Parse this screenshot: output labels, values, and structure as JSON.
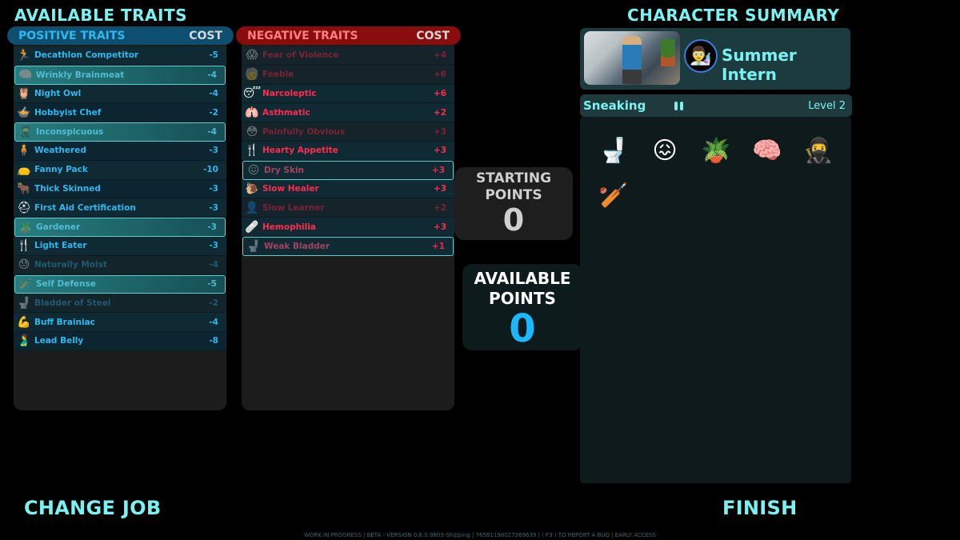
{
  "headings": {
    "available_traits": "AVAILABLE TRAITS",
    "character_summary": "CHARACTER SUMMARY"
  },
  "positive": {
    "title": "POSITIVE TRAITS",
    "cost_label": "COST",
    "traits": [
      {
        "name": "Decathlon Competitor",
        "cost": "-5",
        "icon": "runner-icon",
        "glyph": "🏃",
        "state": "available"
      },
      {
        "name": "Wrinkly Brainmeat",
        "cost": "-4",
        "icon": "brain-icon",
        "glyph": "🧠",
        "state": "selected"
      },
      {
        "name": "Night Owl",
        "cost": "-4",
        "icon": "owl-icon",
        "glyph": "🦉",
        "state": "available"
      },
      {
        "name": "Hobbyist Chef",
        "cost": "-2",
        "icon": "cooking-pot-icon",
        "glyph": "🍲",
        "state": "available"
      },
      {
        "name": "Inconspicuous",
        "cost": "-4",
        "icon": "ninja-icon",
        "glyph": "🥷",
        "state": "selected"
      },
      {
        "name": "Weathered",
        "cost": "-3",
        "icon": "weathered-person-icon",
        "glyph": "🧍",
        "state": "available"
      },
      {
        "name": "Fanny Pack",
        "cost": "-10",
        "icon": "fanny-pack-icon",
        "glyph": "👝",
        "state": "available"
      },
      {
        "name": "Thick Skinned",
        "cost": "-3",
        "icon": "hide-icon",
        "glyph": "🐂",
        "state": "available"
      },
      {
        "name": "First Aid Certification",
        "cost": "-3",
        "icon": "medic-icon",
        "glyph": "⛑",
        "state": "available"
      },
      {
        "name": "Gardener",
        "cost": "-3",
        "icon": "potted-plant-icon",
        "glyph": "🪴",
        "state": "selected"
      },
      {
        "name": "Light Eater",
        "cost": "-3",
        "icon": "fork-knife-icon",
        "glyph": "🍴",
        "state": "available"
      },
      {
        "name": "Naturally Moist",
        "cost": "-4",
        "icon": "sweaty-face-icon",
        "glyph": "😓",
        "state": "disabled"
      },
      {
        "name": "Self Defense",
        "cost": "-5",
        "icon": "baseball-bat-icon",
        "glyph": "🏏",
        "state": "selected"
      },
      {
        "name": "Bladder of Steel",
        "cost": "-2",
        "icon": "toilet-icon",
        "glyph": "🚽",
        "state": "disabled"
      },
      {
        "name": "Buff Brainiac",
        "cost": "-4",
        "icon": "buff-brain-icon",
        "glyph": "💪",
        "state": "available"
      },
      {
        "name": "Lead Belly",
        "cost": "-8",
        "icon": "stomach-icon",
        "glyph": "🫃",
        "state": "available"
      }
    ]
  },
  "negative": {
    "title": "NEGATIVE TRAITS",
    "cost_label": "COST",
    "traits": [
      {
        "name": "Fear of Violence",
        "cost": "+4",
        "icon": "scared-face-icon",
        "glyph": "😱",
        "state": "disabled"
      },
      {
        "name": "Feeble",
        "cost": "+6",
        "icon": "elderly-cane-icon",
        "glyph": "🧓",
        "state": "disabled"
      },
      {
        "name": "Narcoleptic",
        "cost": "+6",
        "icon": "sleeping-face-icon",
        "glyph": "😴",
        "state": "available"
      },
      {
        "name": "Asthmatic",
        "cost": "+2",
        "icon": "lungs-icon",
        "glyph": "🫁",
        "state": "available"
      },
      {
        "name": "Painfully Obvious",
        "cost": "+3",
        "icon": "obvious-face-icon",
        "glyph": "😳",
        "state": "disabled"
      },
      {
        "name": "Hearty Appetite",
        "cost": "+3",
        "icon": "fork-knife-icon",
        "glyph": "🍴",
        "state": "available"
      },
      {
        "name": "Dry Skin",
        "cost": "+3",
        "icon": "itchy-face-icon",
        "glyph": "😖",
        "state": "selected"
      },
      {
        "name": "Slow Healer",
        "cost": "+3",
        "icon": "snail-icon",
        "glyph": "🐌",
        "state": "available"
      },
      {
        "name": "Slow Learner",
        "cost": "+2",
        "icon": "head-silhouette-icon",
        "glyph": "👤",
        "state": "disabled"
      },
      {
        "name": "Hemophilia",
        "cost": "+3",
        "icon": "bandage-icon",
        "glyph": "🩹",
        "state": "available"
      },
      {
        "name": "Weak Bladder",
        "cost": "+1",
        "icon": "toilet-icon",
        "glyph": "🚽",
        "state": "selected"
      }
    ]
  },
  "points": {
    "starting_label_1": "STARTING",
    "starting_label_2": "POINTS",
    "starting_value": "0",
    "available_label_1": "AVAILABLE",
    "available_label_2": "POINTS",
    "available_value": "0"
  },
  "character": {
    "job_name": "Summer Intern",
    "job_avatar_icon": "scientist-avatar-icon",
    "skill_name": "Sneaking",
    "skill_level": "Level 2",
    "skill_pips": 2,
    "selected_trait_icons": [
      {
        "icon": "toilet-icon",
        "glyph": "🚽"
      },
      {
        "icon": "itchy-face-icon",
        "glyph": "😖"
      },
      {
        "icon": "potted-plant-icon",
        "glyph": "🪴"
      },
      {
        "icon": "brain-icon",
        "glyph": "🧠"
      },
      {
        "icon": "ninja-icon",
        "glyph": "🥷"
      },
      {
        "icon": "baseball-bat-icon",
        "glyph": "🏏"
      }
    ]
  },
  "buttons": {
    "change_job": "CHANGE JOB",
    "finish": "FINISH"
  },
  "footer": "WORK IN PROGRESS | BETA - VERSION 0.8.0.9803-Shipping | 76561198027369639 | ( F3 ) TO REPORT A BUG | EARLY ACCESS",
  "colors": {
    "accent_cyan": "#7af2f2",
    "positive_blue": "#2cb8f0",
    "negative_red": "#ff2a50",
    "available_points_blue": "#1ab8ff"
  }
}
